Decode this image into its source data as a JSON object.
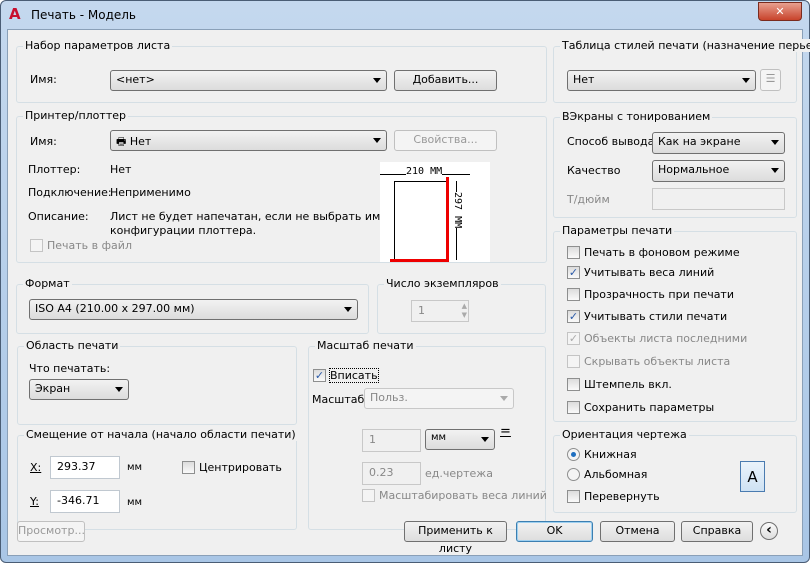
{
  "window": {
    "title": "Печать - Модель",
    "close": "✕",
    "logo": "A"
  },
  "page_setup": {
    "legend": "Набор параметров листа",
    "name_label": "Имя:",
    "name_value": "<нет>",
    "add_button": "Добавить..."
  },
  "printer": {
    "legend": "Принтер/плоттер",
    "name_label": "Имя:",
    "name_value": "Нет",
    "properties_button": "Свойства...",
    "plotter_label": "Плоттер:",
    "plotter_value": "Нет",
    "where_label": "Подключение:",
    "where_value": "Неприменимо",
    "desc_label": "Описание:",
    "desc_line1": "Лист не будет напечатан, если не выбрать имя",
    "desc_line2": "конфигурации плоттера.",
    "print_to_file": "Печать в файл",
    "preview_width": "210 ММ",
    "preview_height": "297 ММ"
  },
  "paper": {
    "legend": "Формат",
    "value": "ISO A4 (210.00 x 297.00 мм)"
  },
  "copies": {
    "legend": "Число экземпляров",
    "value": "1"
  },
  "area": {
    "legend": "Область печати",
    "what_label": "Что печатать:",
    "what_value": "Экран"
  },
  "offset": {
    "legend": "Смещение от начала (начало области печати)",
    "x_label": "X:",
    "x_value": "293.37",
    "y_label": "Y:",
    "y_value": "-346.71",
    "unit": "мм",
    "center": "Центрировать"
  },
  "scale": {
    "legend": "Масштаб печати",
    "fit": "Вписать",
    "scale_label": "Масштаб:",
    "scale_value": "Польз.",
    "num": "1",
    "unit": "мм",
    "eq": "=",
    "den": "0.23",
    "den_unit": "ед.чертежа",
    "lineweights": "Масштабировать веса линий"
  },
  "style_table": {
    "legend": "Таблица стилей печати (назначение перьев)",
    "value": "Нет"
  },
  "shaded": {
    "legend": "ВЭкраны с тонированием",
    "mode_label": "Способ вывода",
    "mode_value": "Как на экране",
    "quality_label": "Качество",
    "quality_value": "Нормальное",
    "dpi_label": "Т/дюйм",
    "dpi_value": ""
  },
  "options": {
    "legend": "Параметры печати",
    "items": [
      {
        "label": "Печать в фоновом режиме",
        "checked": false,
        "disabled": false
      },
      {
        "label": "Учитывать веса линий",
        "checked": true,
        "disabled": false
      },
      {
        "label": "Прозрачность при печати",
        "checked": false,
        "disabled": false
      },
      {
        "label": "Учитывать стили печати",
        "checked": true,
        "disabled": false
      },
      {
        "label": "Объекты листа последними",
        "checked": true,
        "disabled": true
      },
      {
        "label": "Скрывать объекты листа",
        "checked": false,
        "disabled": true
      },
      {
        "label": "Штемпель вкл.",
        "checked": false,
        "disabled": false
      },
      {
        "label": "Сохранить параметры",
        "checked": false,
        "disabled": false
      }
    ]
  },
  "orientation": {
    "legend": "Ориентация чертежа",
    "portrait": "Книжная",
    "landscape": "Альбомная",
    "upside": "Перевернуть",
    "selected": "portrait",
    "icon_letter": "A"
  },
  "buttons": {
    "preview": "Просмотр...",
    "apply": "Применить к листу",
    "ok": "OK",
    "cancel": "Отмена",
    "help": "Справка",
    "collapse": "‹"
  }
}
